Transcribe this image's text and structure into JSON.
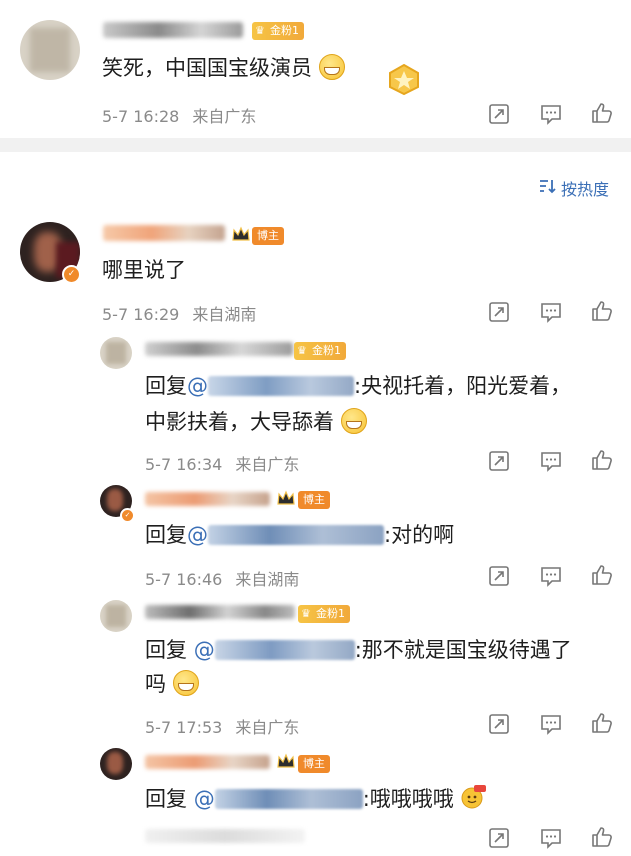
{
  "sort": {
    "label": "按热度"
  },
  "comments": [
    {
      "text": "笑死，中国国宝级演员",
      "time": "5-7 16:28",
      "location": "来自广东",
      "badge": "金粉1"
    },
    {
      "text": "哪里说了",
      "time": "5-7 16:29",
      "location": "来自湖南",
      "badge": "博主"
    }
  ],
  "replies": [
    {
      "prefix": "回复",
      "text_line1": ":央视托着，阳光爱着，",
      "text_line2": "中影扶着，大导舔着",
      "time": "5-7 16:34",
      "location": "来自广东",
      "badge": "金粉1"
    },
    {
      "prefix": "回复",
      "text_line1": ":对的啊",
      "time": "5-7 16:46",
      "location": "来自湖南",
      "badge": "博主"
    },
    {
      "prefix": "回复",
      "text_line1": ":那不就是国宝级待遇了",
      "text_line2": "吗",
      "time": "5-7 17:53",
      "location": "来自广东",
      "badge": "金粉1"
    },
    {
      "prefix": "回复",
      "text_line1": ":哦哦哦哦",
      "badge": "博主"
    }
  ],
  "icons": {
    "share": "share-icon",
    "comment": "comment-icon",
    "like": "thumbs-up-icon",
    "sort": "sort-icon",
    "crown": "crown-icon"
  },
  "colors": {
    "accent_blue": "#3b6fb6",
    "badge_orange": "#f08a2b",
    "badge_gold": "#f6c445",
    "meta_gray": "#8a8a8a"
  }
}
